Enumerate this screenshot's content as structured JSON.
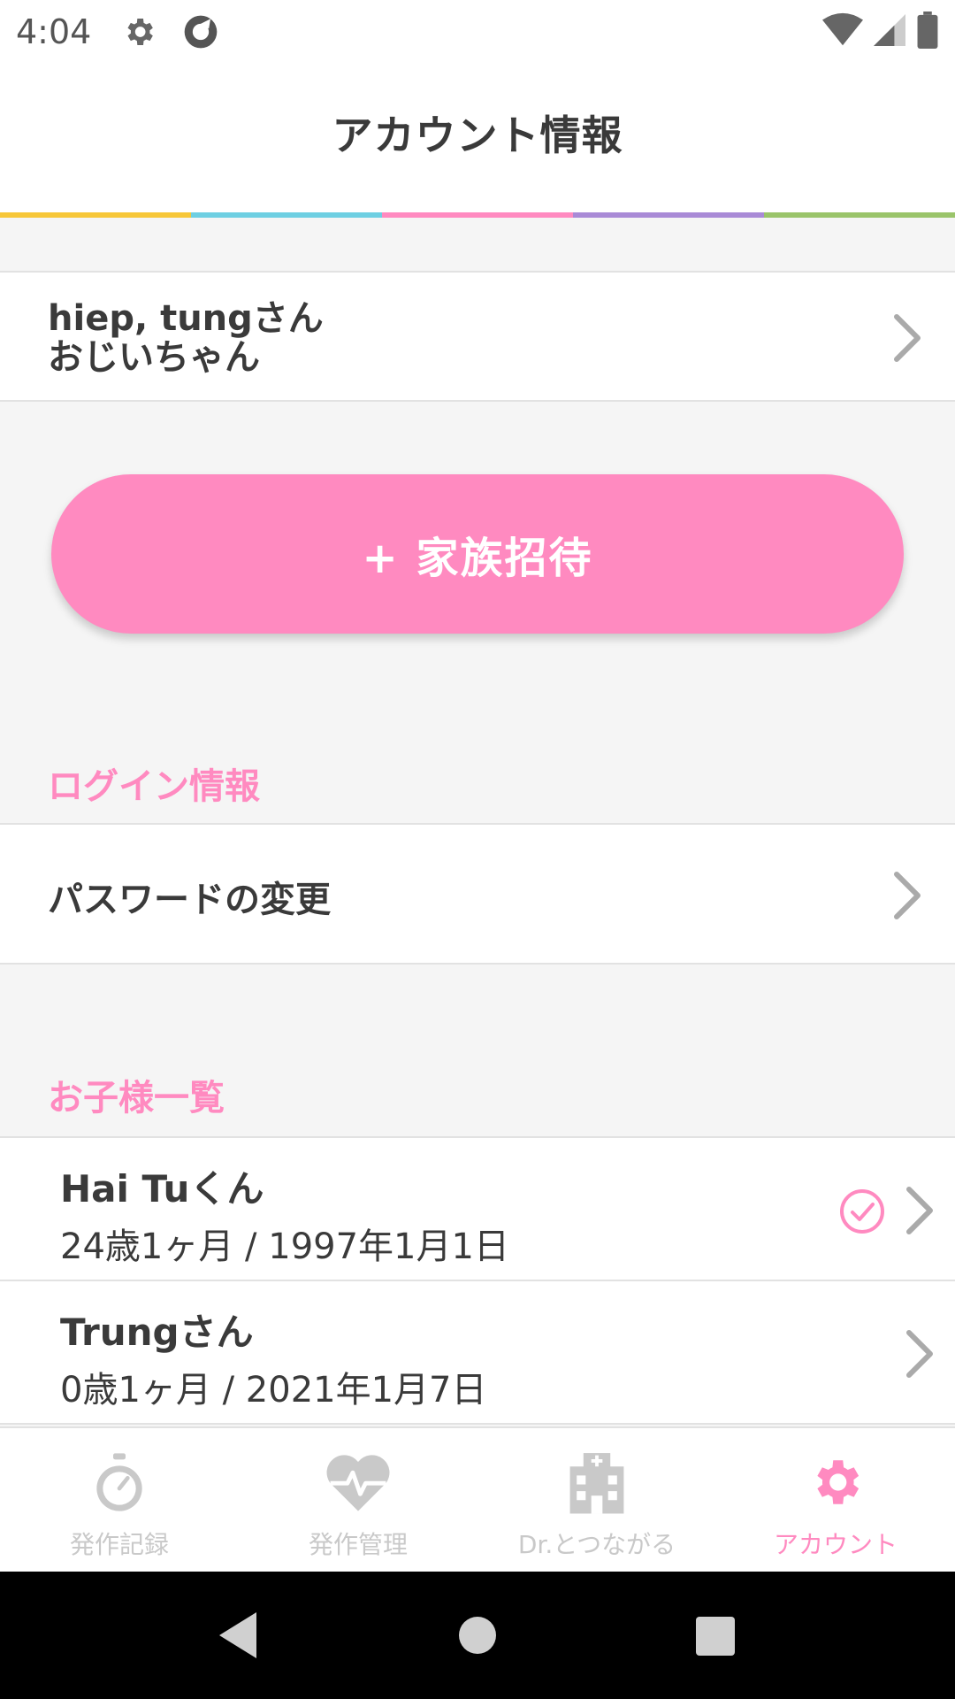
{
  "status_bar": {
    "time": "4:04",
    "icons": [
      "gear-icon",
      "sync-icon",
      "wifi-icon",
      "signal-icon",
      "battery-icon"
    ]
  },
  "header": {
    "title": "アカウント情報"
  },
  "rainbow_colors": [
    "#f7c739",
    "#6ecfe2",
    "#ff8ac0",
    "#a98ad6",
    "#9ac46a"
  ],
  "user": {
    "name": "hiep, tungさん",
    "role": "おじいちゃん"
  },
  "invite_button": {
    "label": "+ 家族招待",
    "color": "#ff8ac0"
  },
  "login_section": {
    "heading": "ログイン情報",
    "password_change": "パスワードの変更"
  },
  "children_section": {
    "heading": "お子様一覧",
    "children": [
      {
        "name": "Hai Tuくん",
        "info": "24歳1ヶ月 / 1997年1月1日",
        "selected": true
      },
      {
        "name": "Trungさん",
        "info": "0歳1ヶ月 / 2021年1月7日",
        "selected": false
      }
    ]
  },
  "bottom_nav": {
    "items": [
      {
        "label": "発作記録",
        "icon": "stopwatch-icon",
        "active": false
      },
      {
        "label": "発作管理",
        "icon": "heart-pulse-icon",
        "active": false
      },
      {
        "label": "Dr.とつながる",
        "icon": "hospital-icon",
        "active": false
      },
      {
        "label": "アカウント",
        "icon": "gear-icon",
        "active": true
      }
    ]
  },
  "colors": {
    "accent": "#ff8ac0",
    "inactive": "#c9c9c9"
  }
}
